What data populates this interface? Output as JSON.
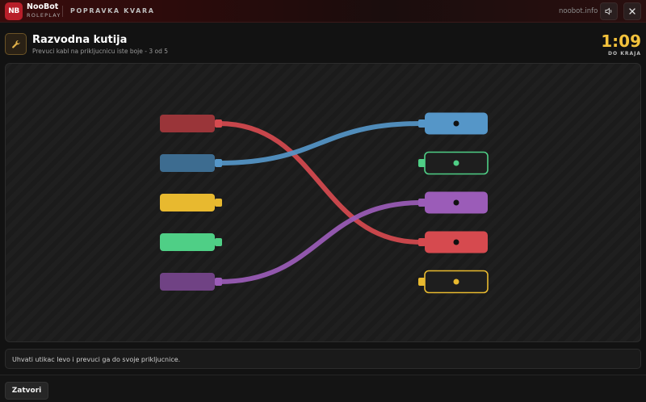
{
  "app": {
    "logo_text": "NB",
    "brand_name": "NooBot",
    "brand_sub": "ROLEPLAY",
    "section_title": "POPRAVKA KVARA",
    "site": "noobot.info"
  },
  "header": {
    "title": "Razvodna kutija",
    "subtitle": "Prevuci kabl na prikljucnicu iste boje - 3 od 5",
    "timer": "1:09",
    "timer_label": "DO KRAJA"
  },
  "colors": {
    "red": "#d64a4f",
    "blue": "#5596c8",
    "yellow": "#e8b92f",
    "green": "#4fcf86",
    "purple": "#9b5cb8",
    "accent_timer": "#f3c23c"
  },
  "board": {
    "left_plugs": [
      {
        "color": "red",
        "connected": true
      },
      {
        "color": "blue",
        "connected": true
      },
      {
        "color": "yellow",
        "connected": false
      },
      {
        "color": "green",
        "connected": false
      },
      {
        "color": "purple",
        "connected": true
      }
    ],
    "right_sockets": [
      {
        "color": "blue",
        "filled": true
      },
      {
        "color": "green",
        "filled": false
      },
      {
        "color": "purple",
        "filled": true
      },
      {
        "color": "red",
        "filled": true
      },
      {
        "color": "yellow",
        "filled": false
      }
    ],
    "wires": [
      {
        "from": 0,
        "to": 3,
        "color": "red"
      },
      {
        "from": 1,
        "to": 0,
        "color": "blue"
      },
      {
        "from": 4,
        "to": 2,
        "color": "purple"
      }
    ]
  },
  "instructions": "Uhvati utikac levo i prevuci ga do svoje prikljucnice.",
  "footer": {
    "close_label": "Zatvori"
  },
  "icons": {
    "sound": "speaker-icon",
    "close": "close-icon",
    "tool": "wrench-icon"
  }
}
